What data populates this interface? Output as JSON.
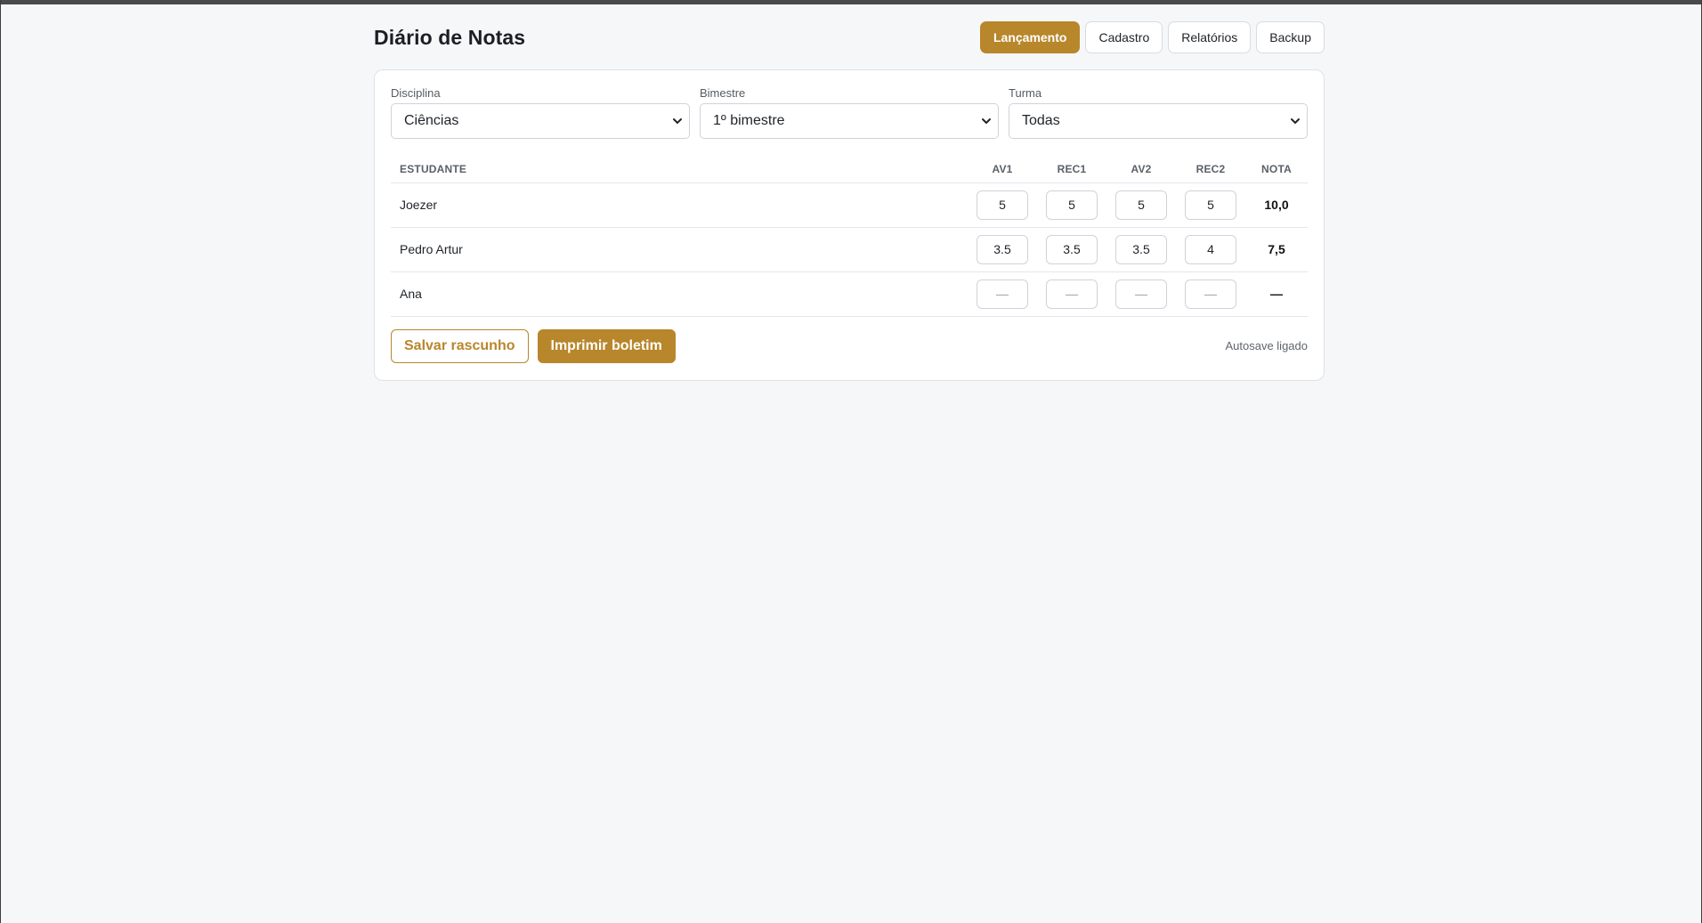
{
  "app": {
    "title": "Diário de Notas"
  },
  "tabs": [
    {
      "label": "Lançamento",
      "active": true
    },
    {
      "label": "Cadastro",
      "active": false
    },
    {
      "label": "Relatórios",
      "active": false
    },
    {
      "label": "Backup",
      "active": false
    }
  ],
  "filters": {
    "disciplina": {
      "label": "Disciplina",
      "value": "Ciências"
    },
    "bimestre": {
      "label": "Bimestre",
      "value": "1º bimestre"
    },
    "turma": {
      "label": "Turma",
      "value": "Todas"
    }
  },
  "table": {
    "headers": [
      "ESTUDANTE",
      "AV1",
      "REC1",
      "AV2",
      "REC2",
      "NOTA"
    ],
    "rows": [
      {
        "student": "Joezer",
        "av1": "5",
        "rec1": "5",
        "av2": "5",
        "rec2": "5",
        "nota": "10,0"
      },
      {
        "student": "Pedro Artur",
        "av1": "3.5",
        "rec1": "3.5",
        "av2": "3.5",
        "rec2": "4",
        "nota": "7,5"
      },
      {
        "student": "Ana",
        "av1": "",
        "rec1": "",
        "av2": "",
        "rec2": "",
        "nota": "—"
      }
    ],
    "empty_placeholder": "—"
  },
  "actions": {
    "save_draft": "Salvar rascunho",
    "print_report": "Imprimir boletim"
  },
  "status": {
    "autosave": "Autosave ligado"
  },
  "colors": {
    "accent": "#b8862b"
  }
}
